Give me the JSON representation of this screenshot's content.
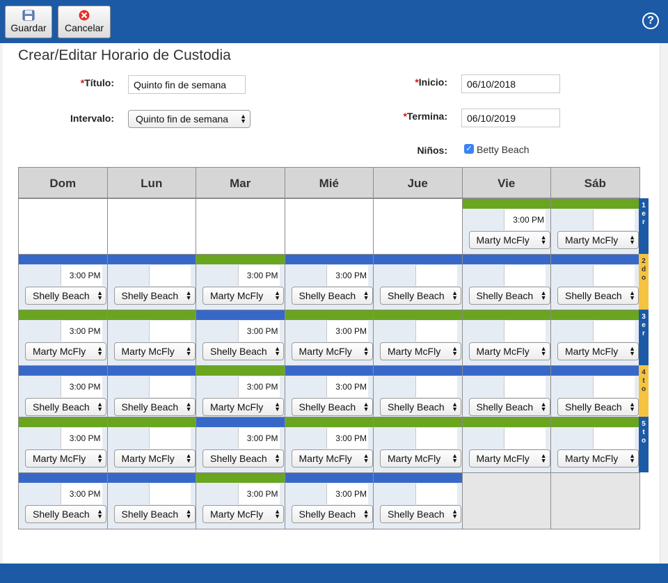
{
  "toolbar": {
    "save_label": "Guardar",
    "cancel_label": "Cancelar",
    "help_symbol": "?"
  },
  "page_title": "Crear/Editar Horario de Custodia",
  "form": {
    "title_label": "Título:",
    "title_value": "Quinto fin de semana",
    "interval_label": "Intervalo:",
    "interval_value": "Quinto fin de semana",
    "start_label": "Inicio:",
    "start_value": "06/10/2018",
    "end_label": "Termina:",
    "end_value": "06/10/2019",
    "children_label": "Niños:",
    "child_name": "Betty Beach",
    "child_checked": true,
    "required_mark": "*"
  },
  "days": [
    "Dom",
    "Lun",
    "Mar",
    "Mié",
    "Jue",
    "Vie",
    "Sáb"
  ],
  "weeks": [
    {
      "label": "1er",
      "tab_color": "#1d5aa6",
      "cells": [
        null,
        null,
        null,
        null,
        null,
        {
          "bar": "green",
          "time": "3:00 PM",
          "parent": "Marty McFly"
        },
        {
          "bar": "green",
          "time": "",
          "parent": "Marty McFly"
        }
      ]
    },
    {
      "label": "2do",
      "tab_color": "#f6c341",
      "cells": [
        {
          "bar": "blue",
          "time": "3:00 PM",
          "parent": "Shelly Beach"
        },
        {
          "bar": "blue",
          "time": "",
          "parent": "Shelly Beach"
        },
        {
          "bar": "green",
          "time": "3:00 PM",
          "parent": "Marty McFly"
        },
        {
          "bar": "blue",
          "time": "3:00 PM",
          "parent": "Shelly Beach"
        },
        {
          "bar": "blue",
          "time": "",
          "parent": "Shelly Beach"
        },
        {
          "bar": "blue",
          "time": "",
          "parent": "Shelly Beach"
        },
        {
          "bar": "blue",
          "time": "",
          "parent": "Shelly Beach"
        }
      ]
    },
    {
      "label": "3er",
      "tab_color": "#1d5aa6",
      "cells": [
        {
          "bar": "green",
          "time": "3:00 PM",
          "parent": "Marty McFly"
        },
        {
          "bar": "green",
          "time": "",
          "parent": "Marty McFly"
        },
        {
          "bar": "blue",
          "time": "3:00 PM",
          "parent": "Shelly Beach"
        },
        {
          "bar": "green",
          "time": "3:00 PM",
          "parent": "Marty McFly"
        },
        {
          "bar": "green",
          "time": "",
          "parent": "Marty McFly"
        },
        {
          "bar": "green",
          "time": "",
          "parent": "Marty McFly"
        },
        {
          "bar": "green",
          "time": "",
          "parent": "Marty McFly"
        }
      ]
    },
    {
      "label": "4to",
      "tab_color": "#f6c341",
      "cells": [
        {
          "bar": "blue",
          "time": "3:00 PM",
          "parent": "Shelly Beach"
        },
        {
          "bar": "blue",
          "time": "",
          "parent": "Shelly Beach"
        },
        {
          "bar": "green",
          "time": "3:00 PM",
          "parent": "Marty McFly"
        },
        {
          "bar": "blue",
          "time": "3:00 PM",
          "parent": "Shelly Beach"
        },
        {
          "bar": "blue",
          "time": "",
          "parent": "Shelly Beach"
        },
        {
          "bar": "blue",
          "time": "",
          "parent": "Shelly Beach"
        },
        {
          "bar": "blue",
          "time": "",
          "parent": "Shelly Beach"
        }
      ]
    },
    {
      "label": "5to",
      "tab_color": "#1d5aa6",
      "cells": [
        {
          "bar": "green",
          "time": "3:00 PM",
          "parent": "Marty McFly"
        },
        {
          "bar": "green",
          "time": "",
          "parent": "Marty McFly"
        },
        {
          "bar": "blue",
          "time": "3:00 PM",
          "parent": "Shelly Beach"
        },
        {
          "bar": "green",
          "time": "3:00 PM",
          "parent": "Marty McFly"
        },
        {
          "bar": "green",
          "time": "",
          "parent": "Marty McFly"
        },
        {
          "bar": "green",
          "time": "",
          "parent": "Marty McFly"
        },
        {
          "bar": "green",
          "time": "",
          "parent": "Marty McFly"
        }
      ]
    },
    {
      "label": "",
      "tab_color": "",
      "cells": [
        {
          "bar": "blue",
          "time": "3:00 PM",
          "parent": "Shelly Beach"
        },
        {
          "bar": "blue",
          "time": "",
          "parent": "Shelly Beach"
        },
        {
          "bar": "green",
          "time": "3:00 PM",
          "parent": "Marty McFly"
        },
        {
          "bar": "blue",
          "time": "3:00 PM",
          "parent": "Shelly Beach"
        },
        {
          "bar": "blue",
          "time": "",
          "parent": "Shelly Beach"
        },
        "gray",
        "gray"
      ]
    }
  ],
  "colors": {
    "header_blue": "#1d5aa6",
    "bar_green": "#6aa51f",
    "bar_blue": "#3768c8",
    "tab_yellow": "#f6c341",
    "required_red": "#d41515"
  }
}
